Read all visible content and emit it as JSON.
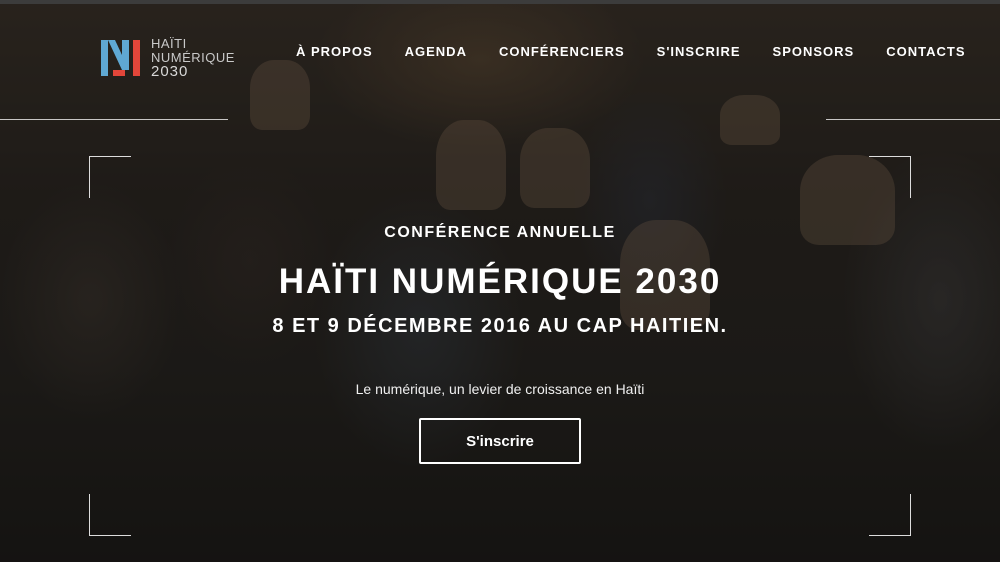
{
  "brand": {
    "logo_line1": "HAÏTI",
    "logo_line2": "NUMÉRIQUE",
    "logo_line3": "2030",
    "colors": {
      "blue": "#5fa8d3",
      "red": "#e2463a",
      "gray": "#c9c9c9"
    }
  },
  "nav": {
    "items": [
      {
        "label": "À PROPOS"
      },
      {
        "label": "AGENDA"
      },
      {
        "label": "CONFÉRENCIERS"
      },
      {
        "label": "S'INSCRIRE"
      },
      {
        "label": "SPONSORS"
      },
      {
        "label": "CONTACTS"
      }
    ]
  },
  "hero": {
    "eyebrow": "CONFÉRENCE ANNUELLE",
    "title": "HAÏTI NUMÉRIQUE 2030",
    "dates": "8 ET 9 DÉCEMBRE 2016 AU CAP HAITIEN.",
    "tagline": "Le numérique, un levier de croissance en Haïti",
    "cta_label": "S'inscrire"
  }
}
